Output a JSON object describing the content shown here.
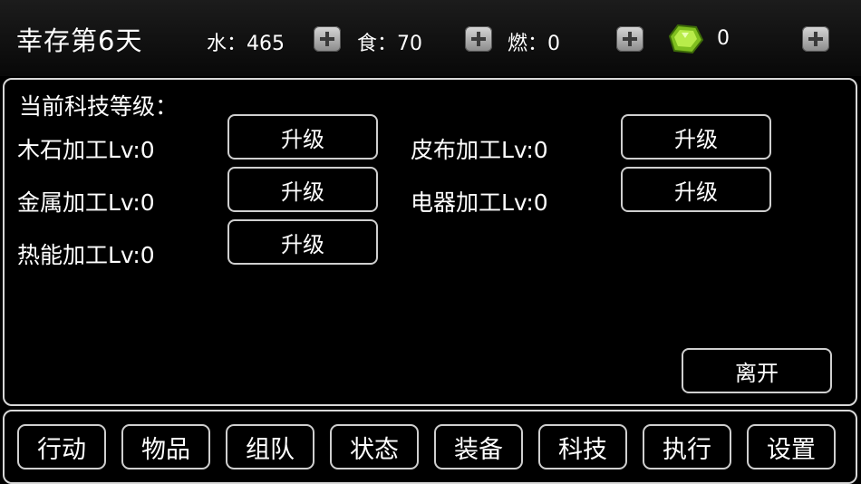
{
  "header": {
    "title": "幸存第6天",
    "water": "水：465",
    "food": "食：70",
    "fuel": "燃：0",
    "gems": "0"
  },
  "tech_panel": {
    "heading": "当前科技等级：",
    "items": [
      {
        "label": "木石加工Lv:0",
        "button": "升级"
      },
      {
        "label": "皮布加工Lv:0",
        "button": "升级"
      },
      {
        "label": "金属加工Lv:0",
        "button": "升级"
      },
      {
        "label": "电器加工Lv:0",
        "button": "升级"
      },
      {
        "label": "热能加工Lv:0",
        "button": "升级"
      }
    ],
    "leave_button": "离开"
  },
  "nav": {
    "items": [
      "行动",
      "物品",
      "组队",
      "状态",
      "装备",
      "科技",
      "执行",
      "设置"
    ]
  },
  "colors": {
    "background": "#000000",
    "border": "#d8d8d8",
    "gem": "#9bd12b"
  }
}
